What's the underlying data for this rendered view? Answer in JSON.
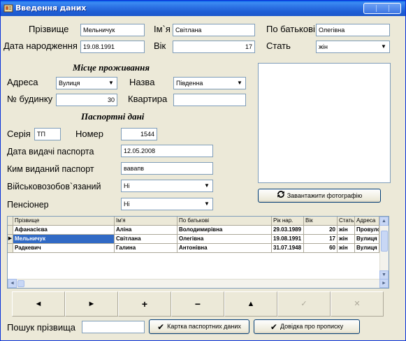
{
  "window": {
    "title": "Введення даних"
  },
  "person": {
    "surname_label": "Прізвище",
    "surname": "Мельничук",
    "name_label": "Ім`я",
    "name": "Світлана",
    "patronymic_label": "По батькові",
    "patronymic": "Олегівна",
    "birthdate_label": "Дата народження",
    "birthdate": "19.08.1991",
    "age_label": "Вік",
    "age": "17",
    "sex_label": "Стать",
    "sex": "жін"
  },
  "residence": {
    "heading": "Місце проживання",
    "address_label": "Адреса",
    "address_type": "Вулиця",
    "street_label": "Назва",
    "street": "Південна",
    "house_label": "№ будинку",
    "house": "30",
    "apartment_label": "Квартира",
    "apartment": ""
  },
  "passport": {
    "heading": "Паспортні дані",
    "series_label": "Серія",
    "series": "ТП",
    "number_label": "Номер",
    "number": "1544",
    "issue_date_label": "Дата видачі паспорта",
    "issue_date": "12.05.2008",
    "issued_by_label": "Ким виданий паспорт",
    "issued_by": "вавапв",
    "military_label": "Військовозобов`язаний",
    "military": "Ні",
    "pensioner_label": "Пенсіонер",
    "pensioner": "Ні"
  },
  "photo": {
    "upload_label": "Завантажити фотографію"
  },
  "table": {
    "columns": [
      "Прізвище",
      "Ім'я",
      "По батькові",
      "Рік нар.",
      "Вік",
      "Стать",
      "Адреса"
    ],
    "rows": [
      [
        "Афанасієва",
        "Аліна",
        "Володимирівна",
        "29.03.1989",
        "20",
        "жін",
        "Провулок"
      ],
      [
        "Мельничук",
        "Світлана",
        "Олегівна",
        "19.08.1991",
        "17",
        "жін",
        "Вулиця"
      ],
      [
        "Радкевич",
        "Галина",
        "Антонівна",
        "31.07.1948",
        "60",
        "жін",
        "Вулиця"
      ]
    ],
    "selected_row": 1
  },
  "navigator": {
    "buttons": [
      {
        "name": "prior",
        "glyph": "◄"
      },
      {
        "name": "next",
        "glyph": "►"
      },
      {
        "name": "insert",
        "glyph": "+"
      },
      {
        "name": "delete",
        "glyph": "−"
      },
      {
        "name": "edit",
        "glyph": "▲"
      },
      {
        "name": "post",
        "glyph": "✓"
      },
      {
        "name": "cancel",
        "glyph": "✕"
      }
    ]
  },
  "footer": {
    "search_label": "Пошук прізвища",
    "search_value": "",
    "passport_card_label": "Картка паспортних даних",
    "registration_label": "Довідка про прописку"
  }
}
